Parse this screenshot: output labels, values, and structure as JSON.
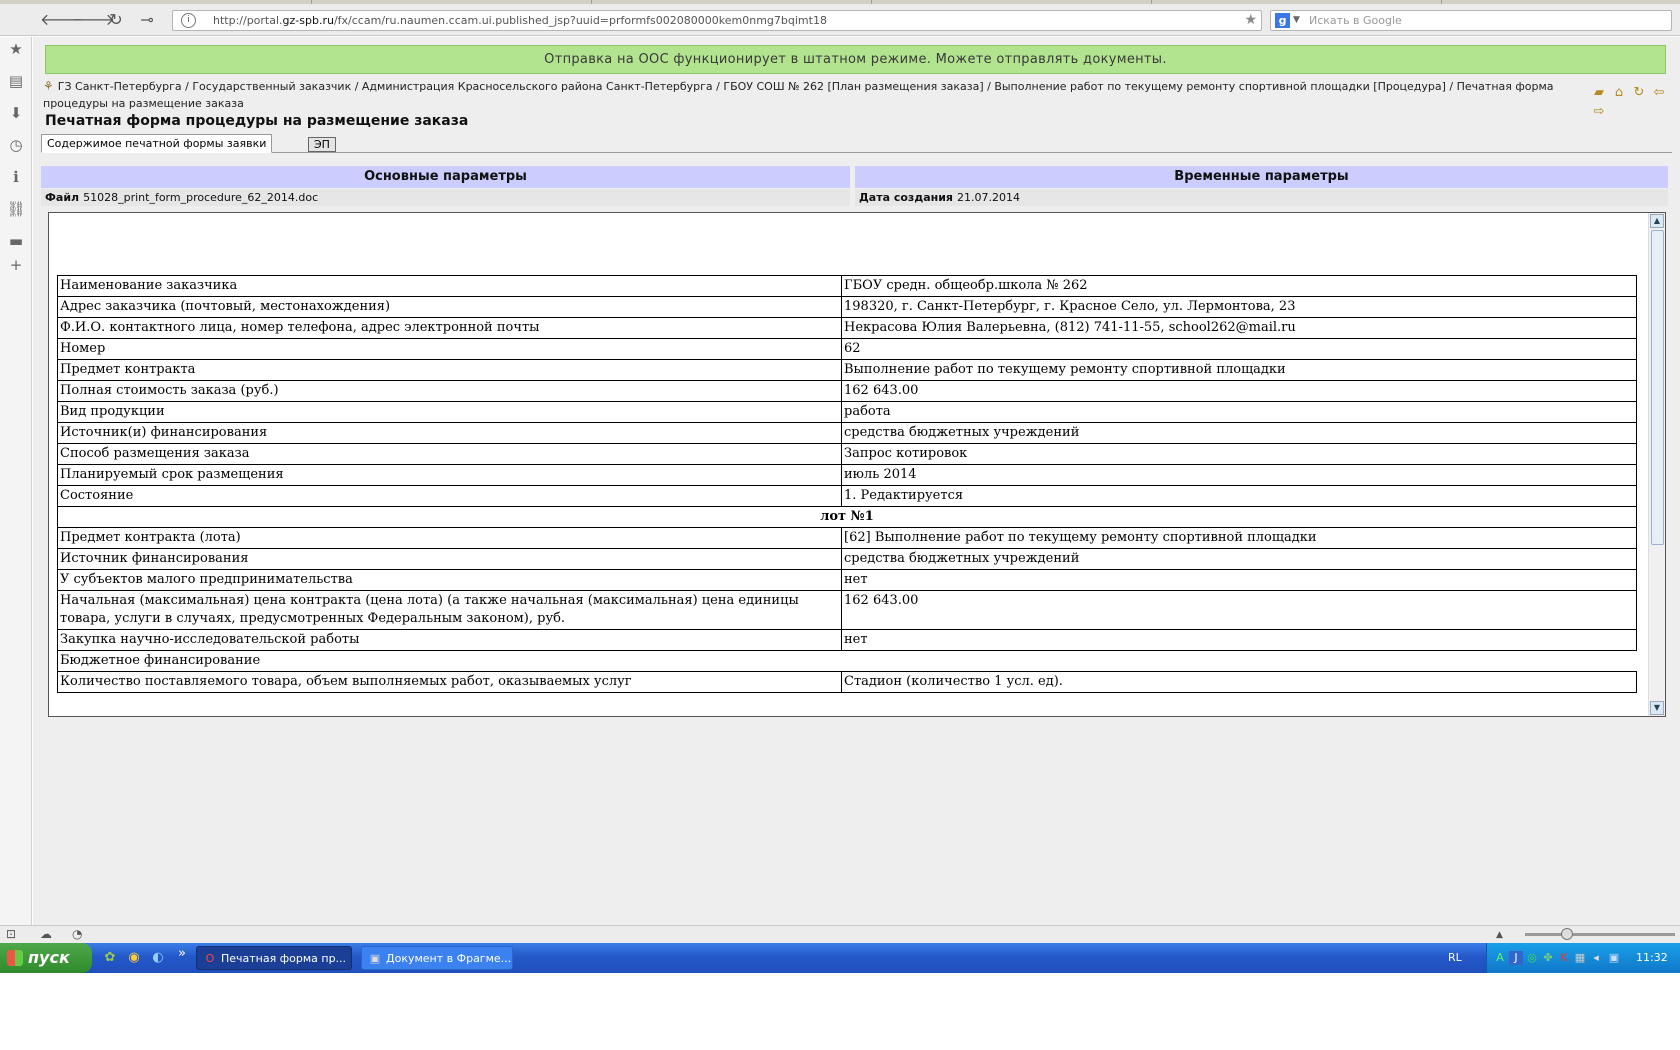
{
  "browser": {
    "nav": {
      "back": "🡐",
      "forward": "🡒",
      "reload": "↻",
      "key": "⊸"
    },
    "url_prefix": "http://portal.",
    "url_domain": "gz-spb.ru",
    "url_rest": "/fx/ccam/ru.naumen.ccam.ui.published_jsp?uuid=prformfs002080000kem0nmg7bqimt18",
    "search_placeholder": "Искать в Google"
  },
  "sidebar_icons": [
    "★",
    "▤",
    "⬇",
    "◷",
    "ℹ",
    "⛓",
    "▬",
    "+"
  ],
  "banner": "Отправка на ООС функционирует в штатном режиме. Можете отправлять документы.",
  "breadcrumb": "ГЗ Санкт-Петербурга / Государственный заказчик / Администрация Красносельского района Санкт-Петербурга / ГБОУ СОШ № 262 [План размещения заказа] / Выполнение работ по текущему ремонту спортивной площадки [Процедура] / Печатная форма процедуры на размещение заказа",
  "page_title": "Печатная форма процедуры на размещение заказа",
  "tabs": {
    "active": "Содержимое печатной формы заявки",
    "other": "ЭП"
  },
  "sections": {
    "main_header": "Основные параметры",
    "time_header": "Временные параметры",
    "file_label": "Файл",
    "file_value": "51028_print_form_procedure_62_2014.doc",
    "date_label": "Дата создания",
    "date_value": "21.07.2014"
  },
  "table": {
    "rows_top": [
      [
        "Наименование заказчика",
        "ГБОУ средн. общеобр.школа № 262"
      ],
      [
        "Адрес заказчика (почтовый, местонахождения)",
        "198320, г. Санкт-Петербург, г. Красное Село, ул. Лермонтова, 23"
      ],
      [
        "Ф.И.О. контактного лица, номер телефона, адрес электронной почты",
        "Некрасова Юлия Валерьевна, (812) 741-11-55, school262@mail.ru"
      ],
      [
        "Номер",
        "62"
      ],
      [
        "Предмет контракта",
        "Выполнение работ по текущему ремонту спортивной площадки"
      ],
      [
        "Полная стоимость заказа (руб.)",
        "162 643.00"
      ],
      [
        "Вид продукции",
        "работа"
      ],
      [
        "Источник(и) финансирования",
        "средства бюджетных учреждений"
      ],
      [
        "Способ размещения заказа",
        "Запрос котировок"
      ],
      [
        "Планируемый срок размещения",
        "июль 2014"
      ],
      [
        "Состояние",
        "1. Редактируется"
      ]
    ],
    "lot": "лот №1",
    "rows_lot": [
      [
        "Предмет контракта (лота)",
        "[62] Выполнение работ по текущему ремонту спортивной площадки"
      ],
      [
        "Источник финансирования",
        "средства бюджетных учреждений"
      ],
      [
        "У субъектов малого предпринимательства",
        "нет"
      ],
      [
        "Начальная (максимальная) цена контракта (цена лота) (а также начальная (максимальная) цена единицы товара, услуги в случаях, предусмотренных Федеральным законом), руб.",
        "162 643.00"
      ],
      [
        "Закупка научно-исследовательской работы",
        "нет"
      ]
    ],
    "budget": "Бюджетное финансирование",
    "qty_label": "Количество поставляемого товара, объем выполняемых работ, оказываемых услуг",
    "qty_value": "Стадион (количество 1 усл. ед)."
  },
  "taskbar": {
    "start": "пуск",
    "quicklaunch": [
      "✿",
      "◉",
      "◐",
      "»"
    ],
    "task_active": "Печатная форма пр...",
    "task_other": "Документ в Фрагме...",
    "lang": "RL",
    "clock": "11:32"
  }
}
